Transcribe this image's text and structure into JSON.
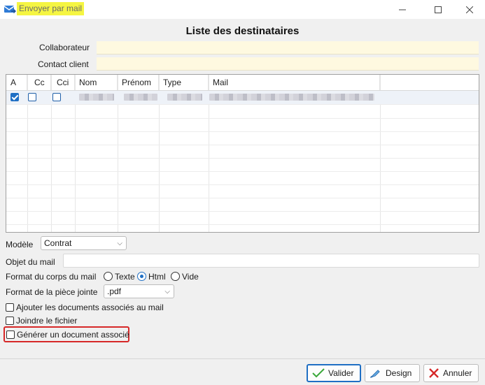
{
  "window": {
    "title": "Envoyer par mail"
  },
  "heading": "Liste des destinataires",
  "fields": {
    "collaborateur_label": "Collaborateur",
    "contact_client_label": "Contact client"
  },
  "grid": {
    "columns": [
      "A",
      "Cc",
      "Cci",
      "Nom",
      "Prénom",
      "Type",
      "Mail"
    ],
    "rows": [
      {
        "A": true,
        "Cc": false,
        "Cci": false
      }
    ]
  },
  "modele": {
    "label": "Modèle",
    "value": "Contrat"
  },
  "objet": {
    "label": "Objet du mail"
  },
  "format_corps": {
    "label": "Format du corps du mail",
    "options": [
      "Texte",
      "Html",
      "Vide"
    ],
    "selected": "Html"
  },
  "format_piece": {
    "label": "Format de la pièce jointe",
    "value": ".pdf"
  },
  "checkboxes": {
    "ajouter": "Ajouter les documents associés au mail",
    "joindre": "Joindre le fichier",
    "generer": "Générer un document associé"
  },
  "buttons": {
    "valider": "Valider",
    "design": "Design",
    "annuler": "Annuler"
  },
  "colors": {
    "accent": "#1f6fc4",
    "title_highlight": "#f5f542",
    "alert": "#d62828"
  }
}
